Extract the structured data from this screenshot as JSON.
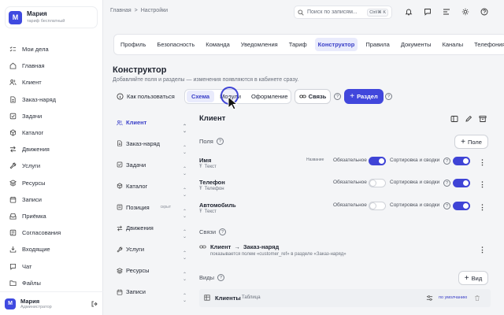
{
  "workspace": {
    "initial": "М",
    "name": "Мария",
    "plan": "тариф бесплатный"
  },
  "menu": [
    {
      "icon": "checklist-icon",
      "label": "Мои дела"
    },
    {
      "icon": "home-icon",
      "label": "Главная"
    },
    {
      "icon": "users-icon",
      "label": "Клиент"
    },
    {
      "icon": "document-icon",
      "label": "Заказ-наряд"
    },
    {
      "icon": "tasks-icon",
      "label": "Задачи"
    },
    {
      "icon": "catalog-icon",
      "label": "Каталог"
    },
    {
      "icon": "movement-icon",
      "label": "Движения"
    },
    {
      "icon": "wrench-icon",
      "label": "Услуги"
    },
    {
      "icon": "resources-icon",
      "label": "Ресурсы"
    },
    {
      "icon": "calendar-icon",
      "label": "Записи"
    },
    {
      "icon": "inbox-icon",
      "label": "Приёмка"
    },
    {
      "icon": "approval-icon",
      "label": "Согласования"
    },
    {
      "icon": "incoming-icon",
      "label": "Входящие"
    },
    {
      "icon": "chat-icon",
      "label": "Чат"
    },
    {
      "icon": "folder-icon",
      "label": "Файлы"
    }
  ],
  "user": {
    "initial": "М",
    "name": "Мария",
    "role": "Администратор"
  },
  "breadcrumbs": {
    "home": "Главная",
    "sep": ">",
    "current": "Настройки"
  },
  "search": {
    "placeholder": "Поиск по записям...",
    "shortcut": "Ctrl/⌘ K"
  },
  "tabs": [
    "Профиль",
    "Безопасность",
    "Команда",
    "Уведомления",
    "Тариф",
    "Конструктор",
    "Правила",
    "Документы",
    "Каналы",
    "Телефония"
  ],
  "active_tab": "Конструктор",
  "page": {
    "title": "Конструктор",
    "subtitle": "Добавляйте поля и разделы — изменения появляются в кабинете сразу."
  },
  "how": {
    "label": "Как пользоваться"
  },
  "segments": [
    "Схема",
    "Модули",
    "Оформление"
  ],
  "active_segment": "Схема",
  "link_button": "Связь",
  "add_section_button": "Раздел",
  "sections": [
    {
      "icon": "users-icon",
      "label": "Клиент",
      "tag": ""
    },
    {
      "icon": "document-icon",
      "label": "Заказ-наряд",
      "tag": ""
    },
    {
      "icon": "tasks-icon",
      "label": "Задачи",
      "tag": ""
    },
    {
      "icon": "catalog-icon",
      "label": "Каталог",
      "tag": ""
    },
    {
      "icon": "position-icon",
      "label": "Позиция",
      "tag": "скрыт"
    },
    {
      "icon": "movement-icon",
      "label": "Движения",
      "tag": ""
    },
    {
      "icon": "wrench-icon",
      "label": "Услуги",
      "tag": ""
    },
    {
      "icon": "resources-icon",
      "label": "Ресурсы",
      "tag": ""
    },
    {
      "icon": "calendar-icon",
      "label": "Записи",
      "tag": ""
    }
  ],
  "active_section": "Клиент",
  "section_detail": {
    "title": "Клиент",
    "fields_label": "Поля",
    "add_field": "Поле",
    "links_label": "Связи",
    "views_label": "Виды",
    "add_view": "Вид"
  },
  "fields": [
    {
      "name": "Имя",
      "type": "Текст",
      "badge": "Название",
      "required": true,
      "sortable": true
    },
    {
      "name": "Телефон",
      "type": "Телефон",
      "badge": "",
      "required": false,
      "sortable": true
    },
    {
      "name": "Автомобиль",
      "type": "Текст",
      "badge": "",
      "required": false,
      "sortable": true
    }
  ],
  "field_labels": {
    "required": "Обязательное",
    "sort": "Сортировка и сводки"
  },
  "relation": {
    "from": "Клиент",
    "arrow": "→",
    "to": "Заказ-наряд",
    "hint": "показывается полем «customer_ref» в разделе «Заказ-наряд»"
  },
  "view": {
    "name": "Клиенты",
    "type": "Таблица",
    "default": "по умолчанию"
  },
  "colors": {
    "accent": "#4147dc",
    "accent_soft": "#e9ebfc"
  }
}
